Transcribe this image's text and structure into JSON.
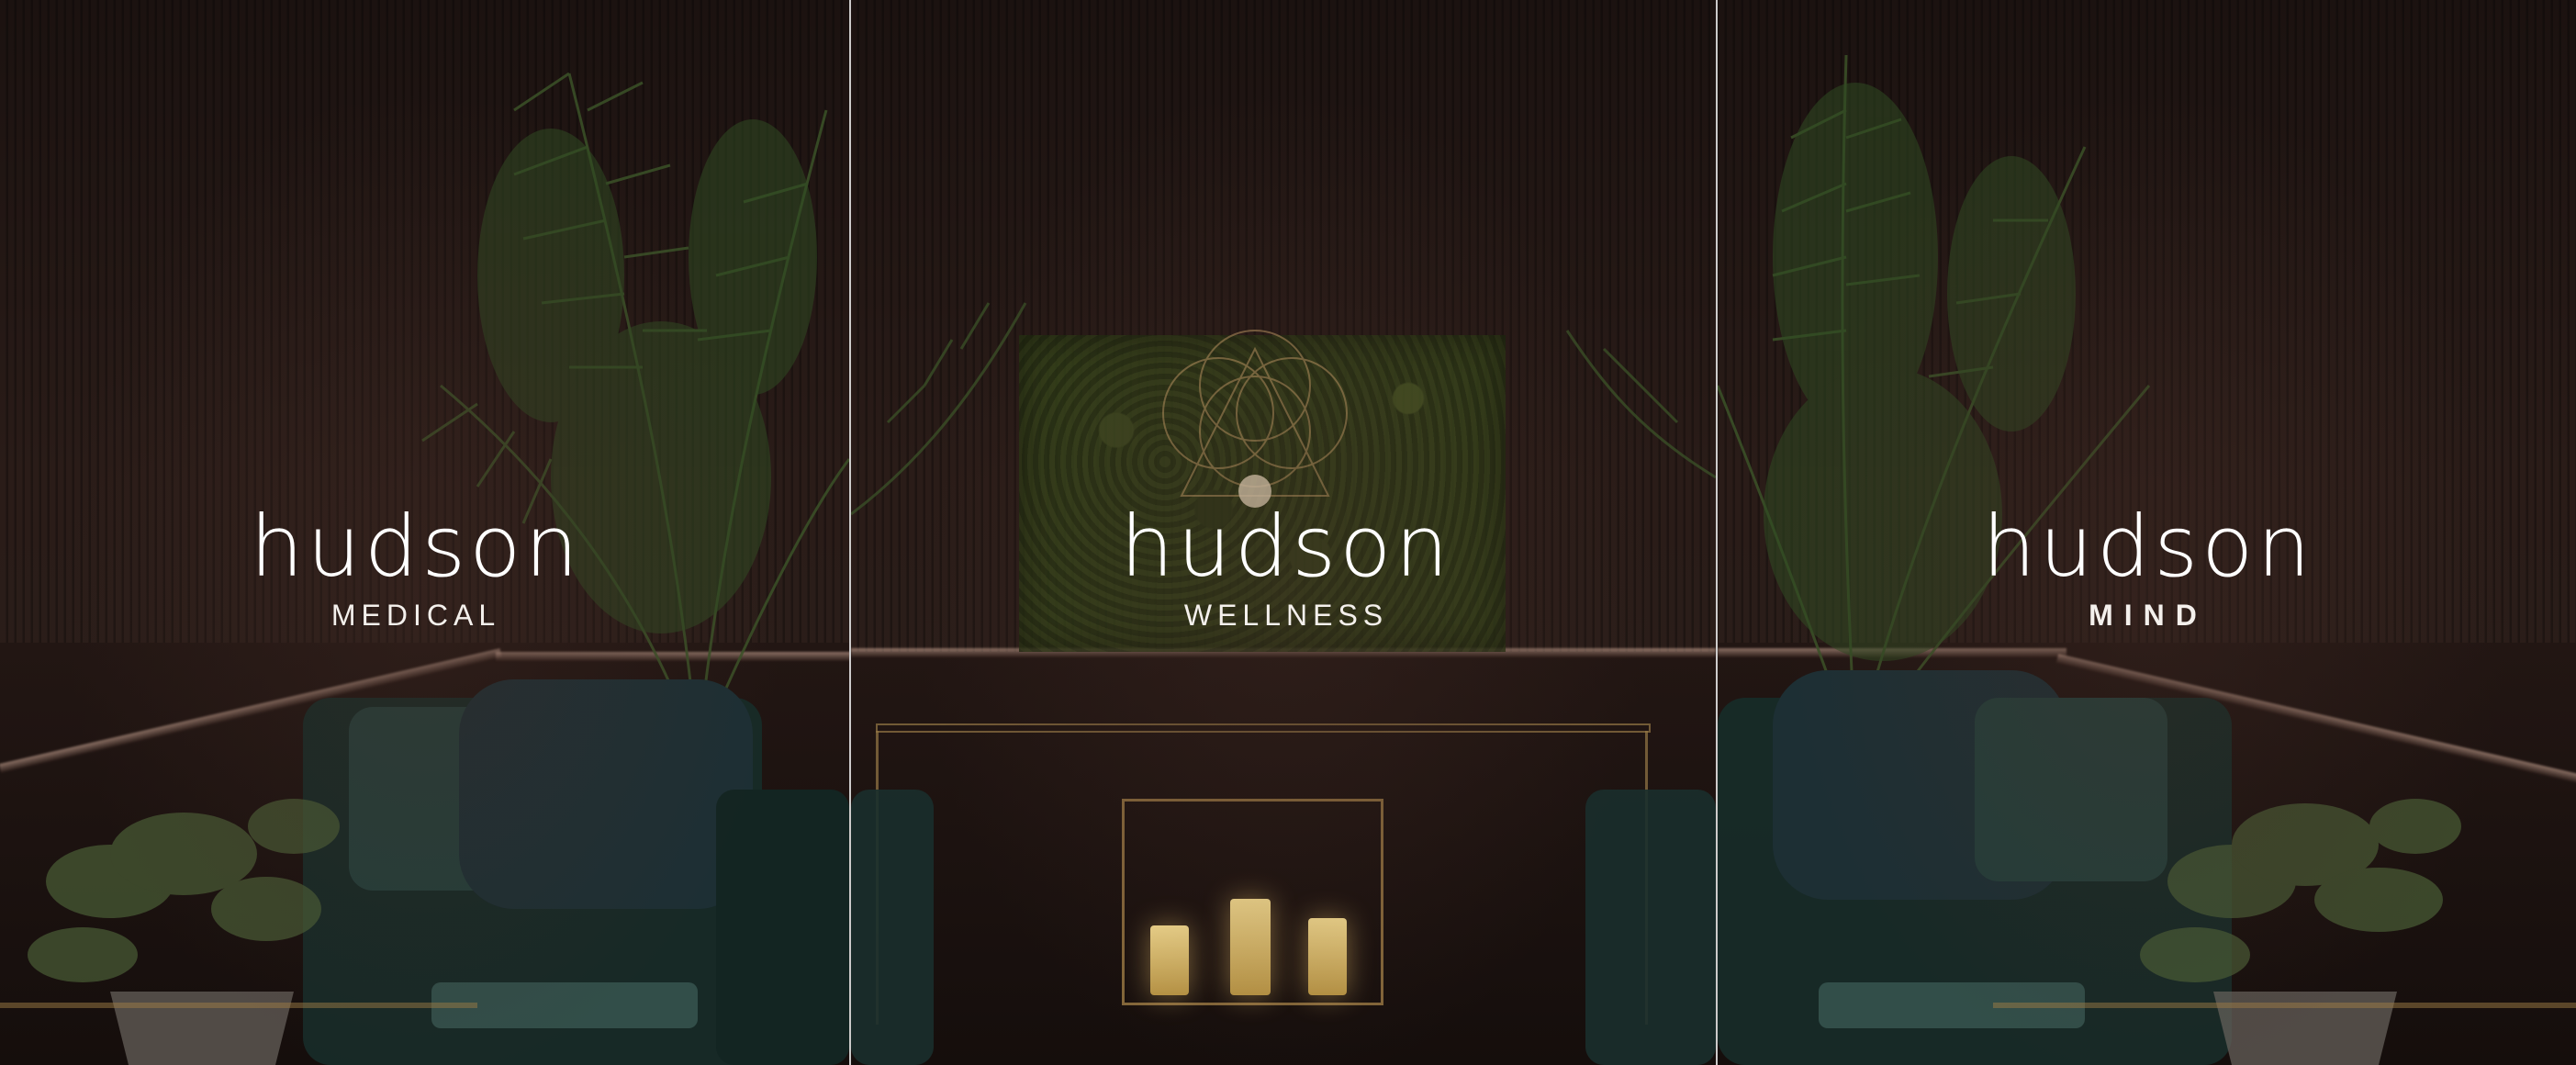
{
  "brands": [
    {
      "wordmark": "hudson",
      "division": "MEDICAL"
    },
    {
      "wordmark": "hudson",
      "division": "WELLNESS"
    },
    {
      "wordmark": "hudson",
      "division": "MIND"
    }
  ],
  "colors": {
    "wall": "#2a1c18",
    "divider": "#ffffff",
    "logo_text": "#ffffff",
    "foliage": "#3f5a2a",
    "velvet_chair": "#1c3330",
    "brass": "#a07d46"
  },
  "icons": [
    "palm-plant-icon",
    "moss-wall-icon",
    "candle-icon",
    "armchair-icon"
  ]
}
